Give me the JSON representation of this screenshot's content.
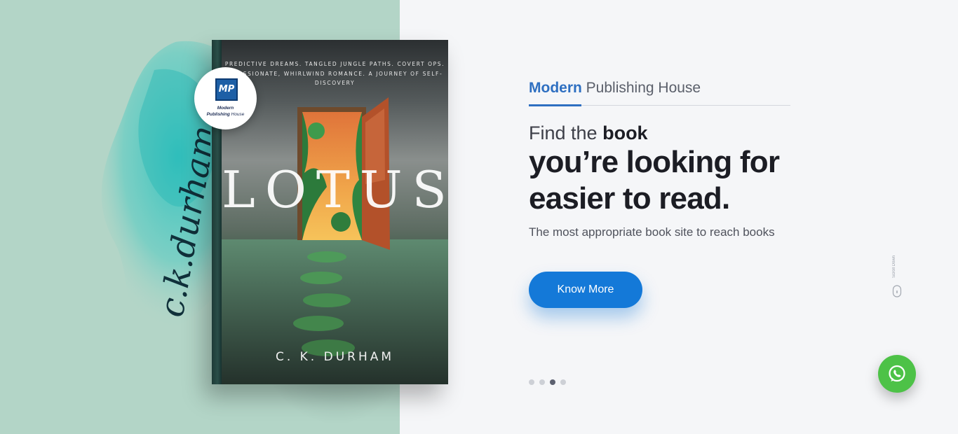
{
  "hero": {
    "book": {
      "tagline": "PREDICTIVE DREAMS. TANGLED JUNGLE PATHS. COVERT OPS. A PASSIONATE, WHIRLWIND ROMANCE. A JOURNEY OF SELF-DISCOVERY",
      "title": "LOTUS",
      "author": "C. K. DURHAM"
    },
    "signature": "c.k.durham",
    "publisher_badge": {
      "logo_text": "MP",
      "name_line1": "Modern",
      "name_line2_bold": "Publishing",
      "name_line2_rest": "House"
    }
  },
  "brand": {
    "strong": "Modern",
    "rest": "Publishing House"
  },
  "headline": {
    "prefix": "Find the",
    "emphasis": "book",
    "line2": "you’re looking for",
    "line3": "easier to read."
  },
  "subtitle": "The most appropriate book site to reach books",
  "cta": {
    "label": "Know More"
  },
  "carousel": {
    "slide_count": 4,
    "active_index": 2
  },
  "scroll_hint": {
    "label": "Scroll Down",
    "icon": "mouse-icon"
  },
  "whatsapp": {
    "icon": "whatsapp-icon"
  },
  "colors": {
    "left_panel": "#b3d5c7",
    "accent_blue": "#2e6fc1",
    "cta_blue": "#1479d8",
    "whatsapp_green": "#4dc247",
    "page_bg": "#f5f6f8"
  }
}
